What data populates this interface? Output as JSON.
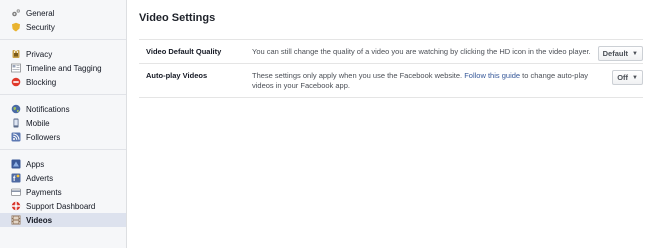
{
  "sidebar": {
    "groups": [
      [
        {
          "label": "General",
          "icon": "gear-icon"
        },
        {
          "label": "Security",
          "icon": "shield-icon"
        }
      ],
      [
        {
          "label": "Privacy",
          "icon": "lock-icon"
        },
        {
          "label": "Timeline and Tagging",
          "icon": "timeline-icon"
        },
        {
          "label": "Blocking",
          "icon": "block-icon"
        }
      ],
      [
        {
          "label": "Notifications",
          "icon": "globe-icon"
        },
        {
          "label": "Mobile",
          "icon": "mobile-icon"
        },
        {
          "label": "Followers",
          "icon": "rss-icon"
        }
      ],
      [
        {
          "label": "Apps",
          "icon": "apps-icon"
        },
        {
          "label": "Adverts",
          "icon": "adverts-icon"
        },
        {
          "label": "Payments",
          "icon": "card-icon"
        },
        {
          "label": "Support Dashboard",
          "icon": "lifebuoy-icon"
        },
        {
          "label": "Videos",
          "icon": "film-icon",
          "selected": true
        }
      ]
    ]
  },
  "main": {
    "title": "Video Settings",
    "rows": {
      "quality": {
        "name": "Video Default Quality",
        "desc": "You can still change the quality of a video you are watching by clicking the HD icon in the video player.",
        "value": "Default"
      },
      "autoplay": {
        "name": "Auto-play Videos",
        "desc_before": "These settings only apply when you use the Facebook website. ",
        "desc_link": "Follow this guide",
        "desc_after": " to change auto-play videos in your Facebook app.",
        "value": "Off"
      }
    }
  },
  "colors": {
    "sidebar_bg": "#f6f7f9",
    "selected_bg": "#dde2ee",
    "link": "#365899"
  }
}
